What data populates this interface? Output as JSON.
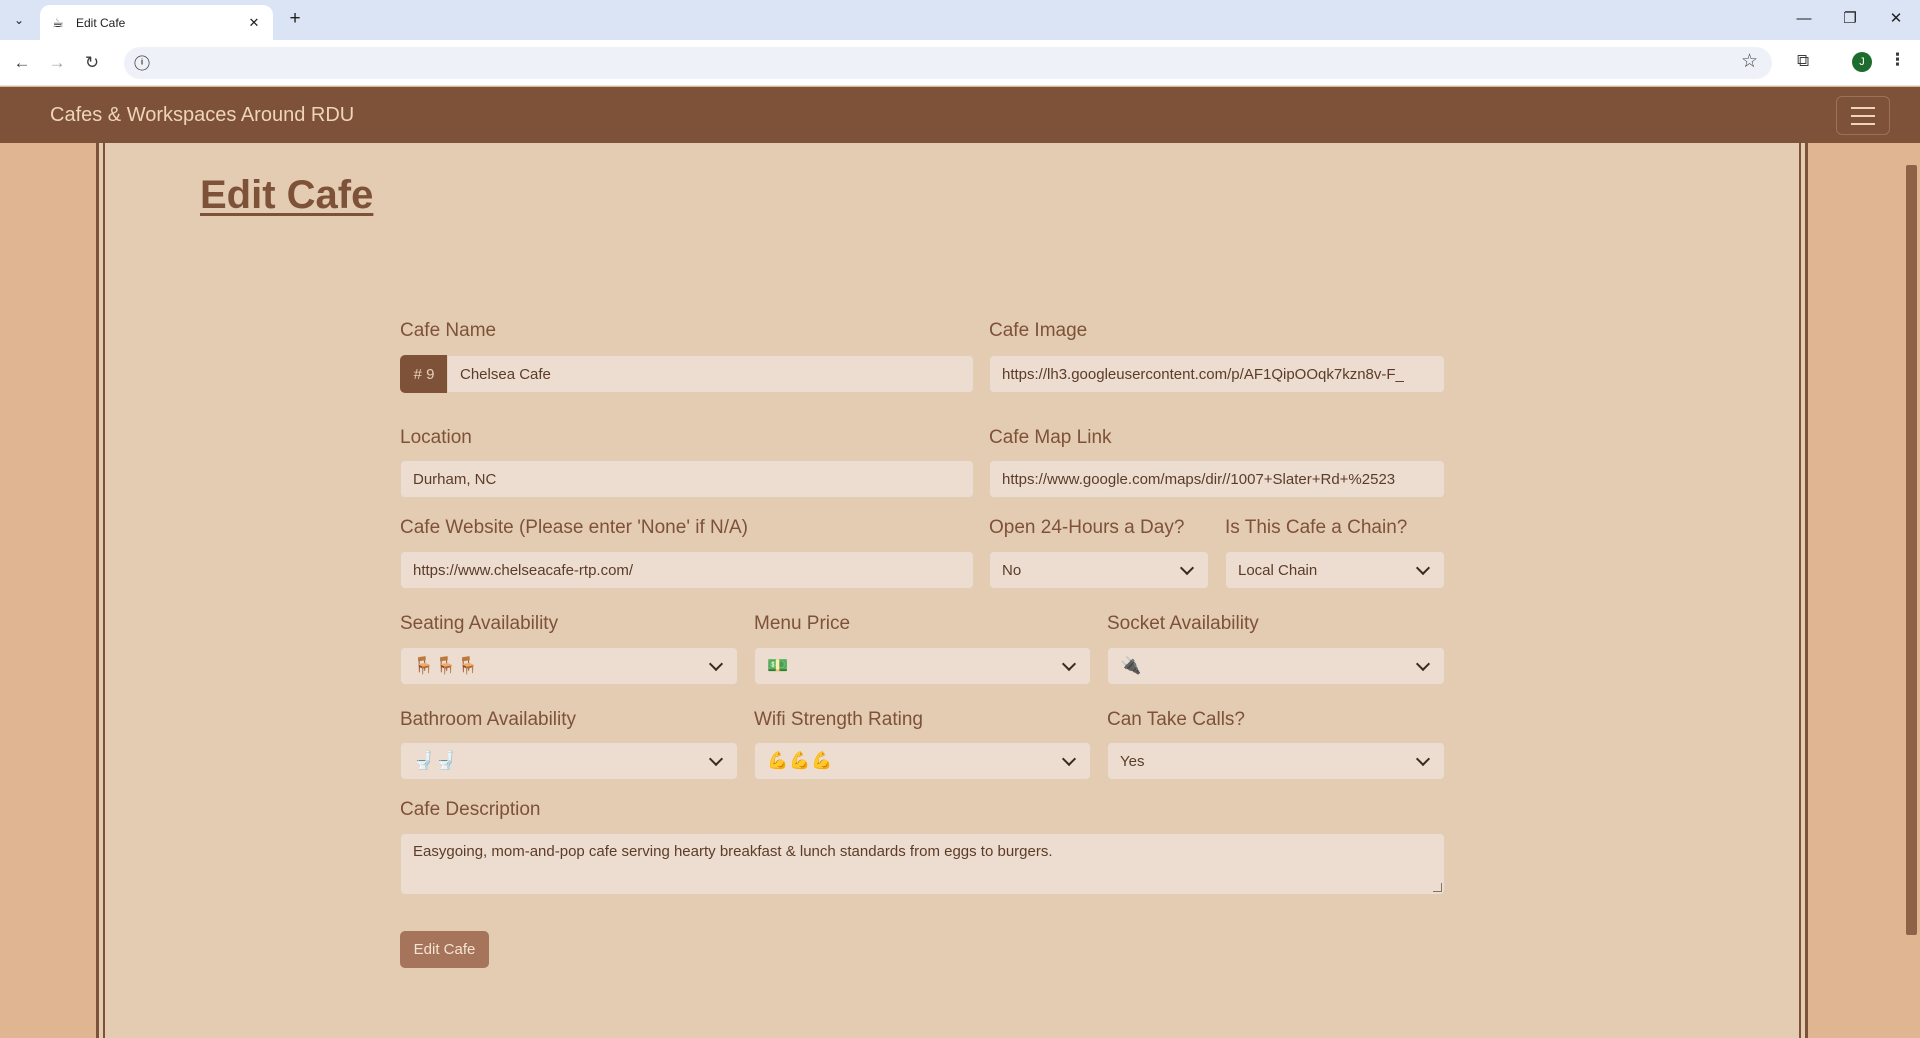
{
  "browser": {
    "tab_title": "Edit Cafe",
    "tab_favicon": "cup-icon",
    "new_tab": "+",
    "profile_initial": "J",
    "address_text": ""
  },
  "navbar": {
    "brand": "Cafes & Workspaces Around RDU"
  },
  "page": {
    "title": "Edit Cafe"
  },
  "form": {
    "cafe_name": {
      "label": "Cafe Name",
      "prefix": "# 9",
      "value": "Chelsea Cafe"
    },
    "cafe_image": {
      "label": "Cafe Image",
      "value": "https://lh3.googleusercontent.com/p/AF1QipOOqk7kzn8v-F_"
    },
    "location": {
      "label": "Location",
      "value": "Durham, NC"
    },
    "map_link": {
      "label": "Cafe Map Link",
      "value": "https://www.google.com/maps/dir//1007+Slater+Rd+%2523"
    },
    "website": {
      "label": "Cafe Website (Please enter 'None' if N/A)",
      "value": "https://www.chelseacafe-rtp.com/"
    },
    "open_24": {
      "label": "Open 24-Hours a Day?",
      "value": "No"
    },
    "chain": {
      "label": "Is This Cafe a Chain?",
      "value": "Local Chain"
    },
    "seating": {
      "label": "Seating Availability",
      "value": "🪑🪑🪑"
    },
    "menu_price": {
      "label": "Menu Price",
      "value": "💵"
    },
    "sockets": {
      "label": "Socket Availability",
      "value": "🔌"
    },
    "bathroom": {
      "label": "Bathroom Availability",
      "value": "🚽🚽"
    },
    "wifi": {
      "label": "Wifi Strength Rating",
      "value": "💪💪💪"
    },
    "calls": {
      "label": "Can Take Calls?",
      "value": "Yes"
    },
    "description": {
      "label": "Cafe Description",
      "value": "Easygoing, mom-and-pop cafe serving hearty breakfast & lunch standards from eggs to burgers."
    },
    "submit_label": "Edit Cafe"
  },
  "colors": {
    "navbar": "#7d5239",
    "page_bg": "#dfb691",
    "panel_bg": "#e4ccb2",
    "accent_text": "#7d5239",
    "button": "#a5745a"
  }
}
